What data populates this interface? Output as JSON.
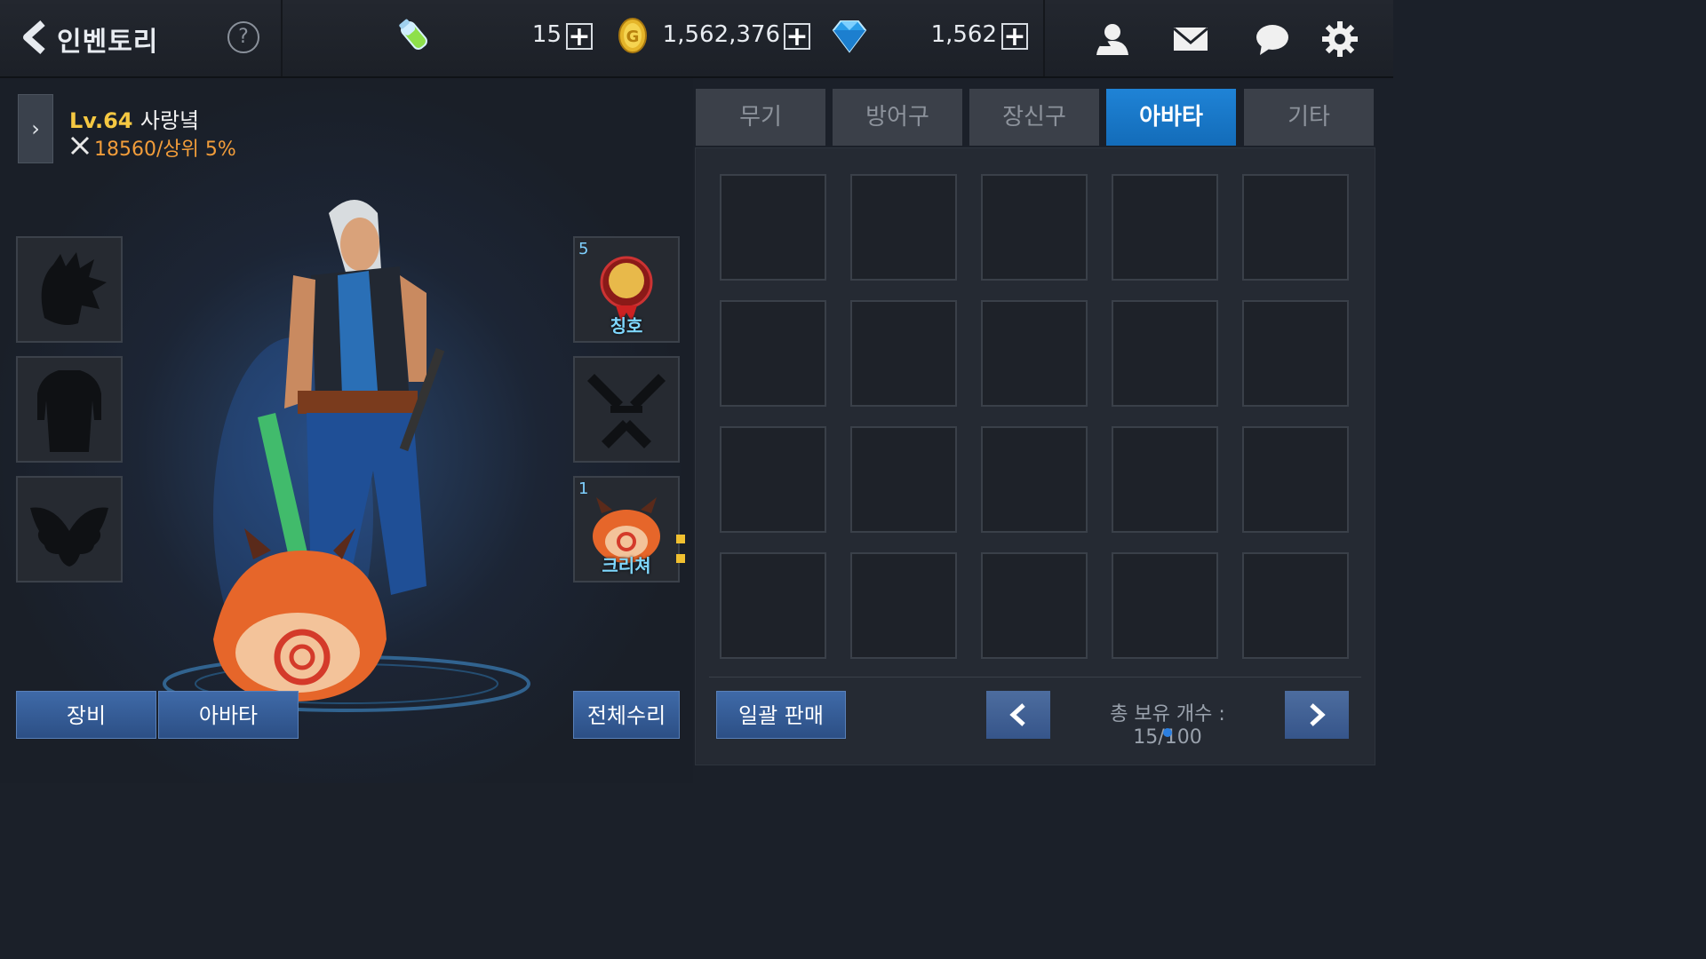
{
  "header": {
    "title": "인벤토리",
    "help_label": "?",
    "stamina": "15",
    "gold": "1,562,376",
    "gems": "1,562",
    "plus_label": "+"
  },
  "character": {
    "level": "Lv.64",
    "name": "사랑녘",
    "power": "18560/상위 5%"
  },
  "side_slots": {
    "title_count": "5",
    "title_label": "칭호",
    "creature_count": "1",
    "creature_label": "크리쳐"
  },
  "buttons": {
    "equip": "장비",
    "avatar": "아바타",
    "repair_all": "전체수리",
    "bulk_sell": "일괄 판매"
  },
  "tabs": [
    {
      "label": "무기",
      "active": false
    },
    {
      "label": "방어구",
      "active": false
    },
    {
      "label": "장신구",
      "active": false
    },
    {
      "label": "아바타",
      "active": true
    },
    {
      "label": "기타",
      "active": false
    }
  ],
  "inventory": {
    "count_text": "총 보유 개수 : 15/100",
    "rows": 4,
    "cols": 5
  },
  "colors": {
    "active_tab": "#1f83d6",
    "button_blue": "#36558a",
    "level_gold": "#f5c842",
    "power_orange": "#f29d3a"
  },
  "icons": [
    "back-arrow-icon",
    "help-icon",
    "stamina-potion-icon",
    "gold-coin-icon",
    "diamond-icon",
    "friend-icon",
    "mail-icon",
    "chat-icon",
    "settings-gear-icon"
  ]
}
